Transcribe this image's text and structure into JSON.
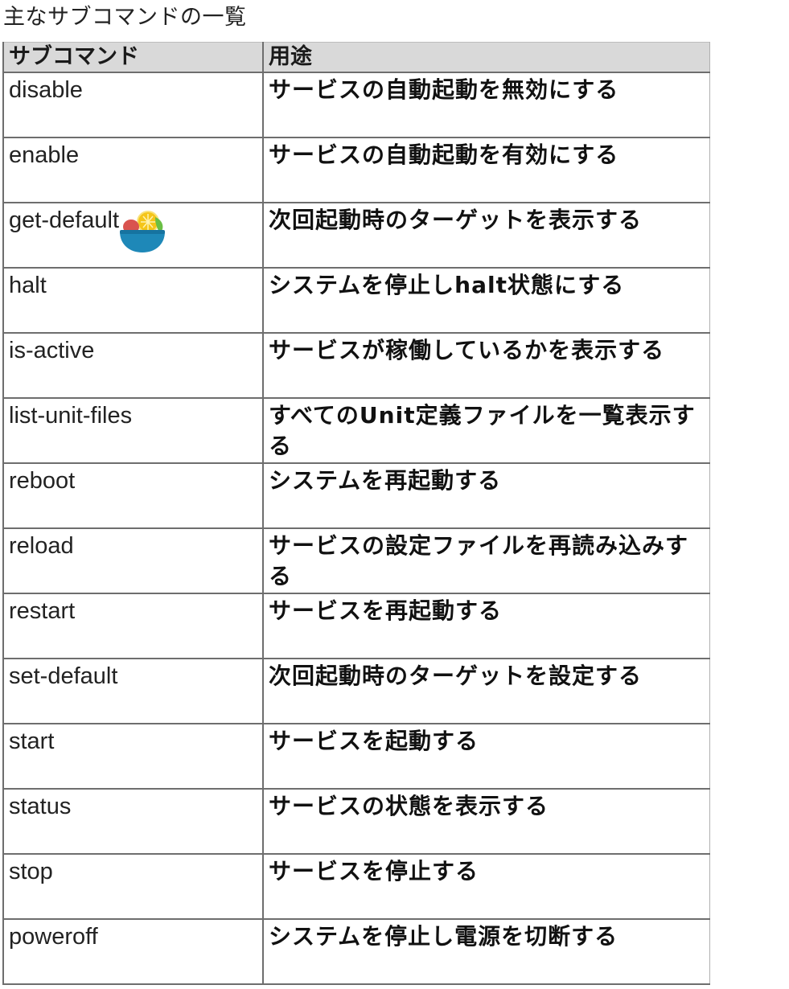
{
  "page": {
    "title": "主なサブコマンドの一覧"
  },
  "table": {
    "headers": [
      "サブコマンド",
      "用途"
    ],
    "rows": [
      {
        "cmd": "disable",
        "use": "サービスの自動起動を無効にする"
      },
      {
        "cmd": "enable",
        "use": "サービスの自動起動を有効にする"
      },
      {
        "cmd": "get-default",
        "use": "次回起動時のターゲットを表示する"
      },
      {
        "cmd": "halt",
        "use": "システムを停止しhalt状態にする"
      },
      {
        "cmd": "is-active",
        "use": "サービスが稼働しているかを表示する"
      },
      {
        "cmd": "list-unit-files",
        "use": "すべてのUnit定義ファイルを一覧表示する"
      },
      {
        "cmd": "reboot",
        "use": "システムを再起動する"
      },
      {
        "cmd": "reload",
        "use": "サービスの設定ファイルを再読み込みする"
      },
      {
        "cmd": "restart",
        "use": "サービスを再起動する"
      },
      {
        "cmd": "set-default",
        "use": "次回起動時のターゲットを設定する"
      },
      {
        "cmd": "start",
        "use": "サービスを起動する"
      },
      {
        "cmd": "status",
        "use": "サービスの状態を表示する"
      },
      {
        "cmd": "stop",
        "use": "サービスを停止する"
      },
      {
        "cmd": "poweroff",
        "use": "システムを停止し電源を切断する"
      }
    ]
  },
  "overlay": {
    "icon": "fruit-bowl-icon",
    "colors": {
      "bowl": "#1e88b8",
      "lemon": "#f5c518",
      "leaf": "#6abf45",
      "fruit": "#d9534f"
    }
  }
}
